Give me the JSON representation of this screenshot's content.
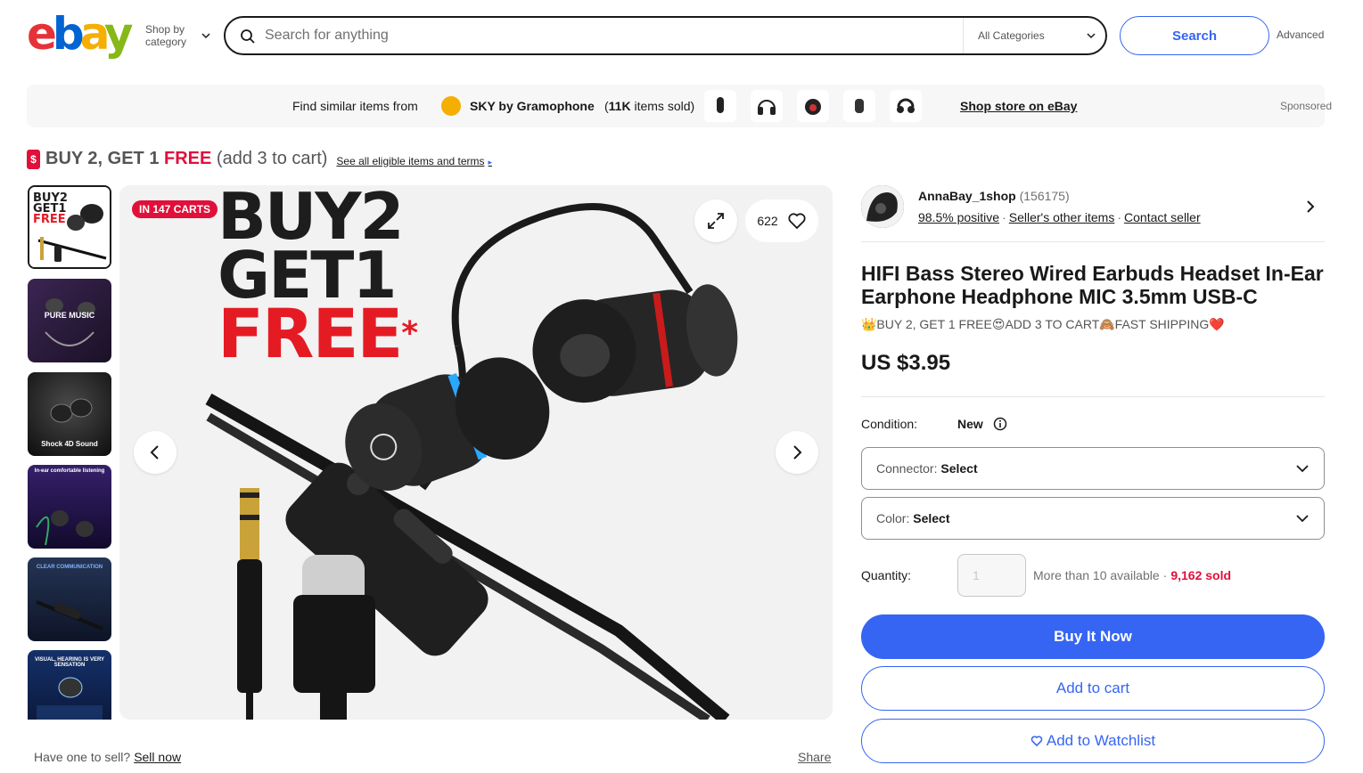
{
  "header": {
    "logo": [
      "e",
      "b",
      "a",
      "y"
    ],
    "shop_by_category": "Shop by category",
    "search_placeholder": "Search for anything",
    "category_select": "All Categories",
    "search_button": "Search",
    "advanced": "Advanced"
  },
  "banner": {
    "find_similar": "Find similar items from",
    "store_name": "SKY by Gramophone",
    "items_sold_count": "11K",
    "items_sold_suffix": "items sold",
    "shop_store": "Shop store on eBay",
    "sponsored": "Sponsored"
  },
  "promo": {
    "tag_icon": "$",
    "buy2": "BUY 2, GET 1 ",
    "free": "FREE",
    "add3": " (add 3 to cart)",
    "link": "See all eligible items and terms",
    "arrow": "▸"
  },
  "gallery": {
    "in_carts": "IN 147 CARTS",
    "big_line1": "BUY2",
    "big_line2": "GET1",
    "big_line3": "FREE",
    "asterisk": "*",
    "watch_count": "622",
    "thumbs": [
      {
        "caption": "",
        "bg": "#ffffff"
      },
      {
        "caption": "PURE MUSIC",
        "bg": "#2a1b3d"
      },
      {
        "caption": "Shock 4D Sound",
        "bg": "#1b1b1b"
      },
      {
        "caption": "In-ear comfortable listening",
        "bg": "#2b1a52"
      },
      {
        "caption": "CLEAR COMMUNICATION",
        "bg": "#1f2a44"
      },
      {
        "caption": "VISUAL, HEARING IS VERY SENSATION",
        "bg": "#0f2550"
      }
    ]
  },
  "footer_left": {
    "have_one": "Have one to sell?",
    "sell_now": "Sell now",
    "share": "Share"
  },
  "seller": {
    "name": "AnnaBay_1shop",
    "feedback": "(156175)",
    "positive": "98.5% positive",
    "other_items": "Seller's other items",
    "contact": "Contact seller"
  },
  "item": {
    "title": "HIFI Bass Stereo Wired Earbuds Headset In-Ear Earphone Headphone MIC 3.5mm USB-C",
    "subtitle": "👑BUY 2, GET 1 FREE😍ADD 3 TO CART🙈FAST SHIPPING❤️",
    "price": "US $3.95",
    "condition_label": "Condition:",
    "condition_value": "New",
    "connector_label": "Connector:",
    "connector_value": "Select",
    "color_label": "Color:",
    "color_value": "Select",
    "quantity_label": "Quantity:",
    "quantity_value": "1",
    "available": "More than 10 available",
    "sold": "9,162 sold",
    "buy_now": "Buy It Now",
    "add_to_cart": "Add to cart",
    "add_to_watchlist": "Add to Watchlist"
  },
  "colors": {
    "accent": "#3665f3",
    "sale_red": "#e0103a"
  }
}
